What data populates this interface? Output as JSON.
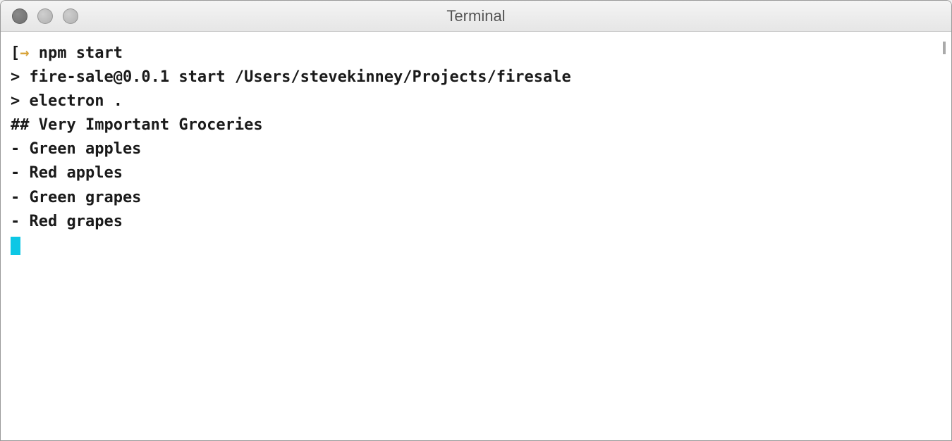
{
  "window": {
    "title": "Terminal"
  },
  "terminal": {
    "prompt_symbol": "→",
    "command": "npm start",
    "lines": {
      "blank1": "",
      "line2": "> fire-sale@0.0.1 start /Users/stevekinney/Projects/firesale",
      "line3": "> electron .",
      "blank2": "",
      "line4": "## Very Important Groceries",
      "blank3": "",
      "line5": "- Green apples",
      "line6": "- Red apples",
      "line7": "- Green grapes",
      "line8": "- Red grapes",
      "blank4": ""
    }
  }
}
